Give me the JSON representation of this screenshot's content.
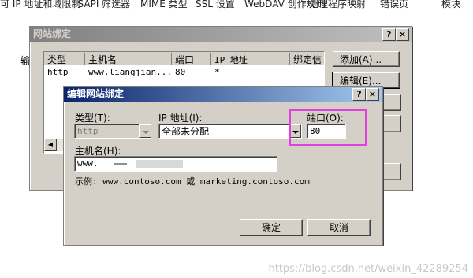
{
  "background_strip": {
    "items": [
      "可 IP 地址和域限制",
      "ISAPI 筛选器",
      "MIME 类型",
      "SSL 设置",
      "WebDAV 创作规则",
      "处理程序映射",
      "错误页",
      "模块"
    ]
  },
  "side_label": "输",
  "site_binding_dialog": {
    "title": "网站绑定",
    "help_button": "?",
    "close_button": "×",
    "table": {
      "columns": [
        "类型",
        "主机名",
        "端口",
        "IP 地址",
        "绑定信"
      ],
      "rows": [
        {
          "type": "http",
          "host": "www.liangjian...",
          "port": "80",
          "ip": "*"
        }
      ]
    },
    "add_button": "添加(A)...",
    "edit_button": "编辑(E)..."
  },
  "edit_binding_dialog": {
    "title": "编辑网站绑定",
    "help_button": "?",
    "close_button": "×",
    "type_label": "类型(T):",
    "type_value": "http",
    "ip_label": "IP 地址(I):",
    "ip_value": "全部未分配",
    "port_label": "端口(O):",
    "port_value": "80",
    "hostname_label": "主机名(H):",
    "hostname_value": "www.",
    "example_text": "示例: www.contoso.com 或 marketing.contoso.com",
    "ok_button": "确定",
    "cancel_button": "取消"
  },
  "highlight_color": "#e040e0",
  "watermark": "https://blog.csdn.net/weixin_42289254"
}
